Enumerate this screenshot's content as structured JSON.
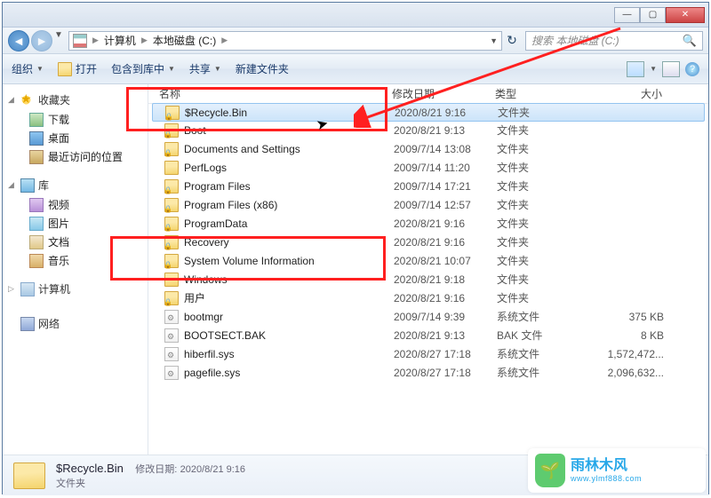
{
  "breadcrumb": {
    "root_icon": "drive-icon",
    "items": [
      "计算机",
      "本地磁盘 (C:)"
    ]
  },
  "search": {
    "placeholder": "搜索 本地磁盘 (C:)"
  },
  "toolbar": {
    "organize": "组织",
    "open": "打开",
    "include": "包含到库中",
    "share": "共享",
    "new_folder": "新建文件夹"
  },
  "tree": {
    "favorites": {
      "label": "收藏夹",
      "items": [
        {
          "label": "下载",
          "icon": "ico-dl"
        },
        {
          "label": "桌面",
          "icon": "ico-desk"
        },
        {
          "label": "最近访问的位置",
          "icon": "ico-recent"
        }
      ]
    },
    "libraries": {
      "label": "库",
      "items": [
        {
          "label": "视频",
          "icon": "ico-vid"
        },
        {
          "label": "图片",
          "icon": "ico-pic"
        },
        {
          "label": "文档",
          "icon": "ico-doc"
        },
        {
          "label": "音乐",
          "icon": "ico-mus"
        }
      ]
    },
    "computer": {
      "label": "计算机"
    },
    "network": {
      "label": "网络"
    }
  },
  "columns": {
    "name": "名称",
    "date": "修改日期",
    "type": "类型",
    "size": "大小"
  },
  "type_labels": {
    "folder": "文件夹",
    "sysfile": "系统文件",
    "bakfile": "BAK 文件"
  },
  "files": [
    {
      "name": "$Recycle.Bin",
      "date": "2020/8/21 9:16",
      "type": "folder",
      "locked": true,
      "selected": true
    },
    {
      "name": "Boot",
      "date": "2020/8/21 9:13",
      "type": "folder",
      "locked": true
    },
    {
      "name": "Documents and Settings",
      "date": "2009/7/14 13:08",
      "type": "folder",
      "locked": true
    },
    {
      "name": "PerfLogs",
      "date": "2009/7/14 11:20",
      "type": "folder",
      "locked": false
    },
    {
      "name": "Program Files",
      "date": "2009/7/14 17:21",
      "type": "folder",
      "locked": true
    },
    {
      "name": "Program Files (x86)",
      "date": "2009/7/14 12:57",
      "type": "folder",
      "locked": true
    },
    {
      "name": "ProgramData",
      "date": "2020/8/21 9:16",
      "type": "folder",
      "locked": true
    },
    {
      "name": "Recovery",
      "date": "2020/8/21 9:16",
      "type": "folder",
      "locked": true
    },
    {
      "name": "System Volume Information",
      "date": "2020/8/21 10:07",
      "type": "folder",
      "locked": true
    },
    {
      "name": "Windows",
      "date": "2020/8/21 9:18",
      "type": "folder",
      "locked": false
    },
    {
      "name": "用户",
      "date": "2020/8/21 9:16",
      "type": "folder",
      "locked": true
    },
    {
      "name": "bootmgr",
      "date": "2009/7/14 9:39",
      "type": "sysfile",
      "size": "375 KB"
    },
    {
      "name": "BOOTSECT.BAK",
      "date": "2020/8/21 9:13",
      "type": "bakfile",
      "size": "8 KB"
    },
    {
      "name": "hiberfil.sys",
      "date": "2020/8/27 17:18",
      "type": "sysfile",
      "size": "1,572,472..."
    },
    {
      "name": "pagefile.sys",
      "date": "2020/8/27 17:18",
      "type": "sysfile",
      "size": "2,096,632..."
    }
  ],
  "statusbar": {
    "name": "$Recycle.Bin",
    "date_label": "修改日期:",
    "date": "2020/8/21 9:16",
    "type": "文件夹"
  },
  "watermark": {
    "brand": "雨林木风",
    "url": "www.ylmf888.com"
  }
}
